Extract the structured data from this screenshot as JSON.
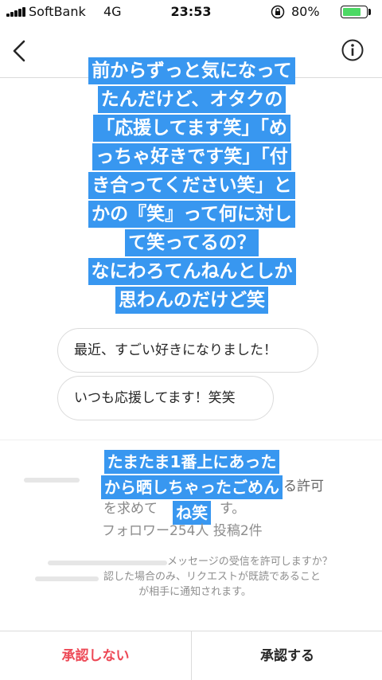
{
  "status_bar": {
    "carrier": "SoftBank",
    "network": "4G",
    "time": "23:53",
    "battery": "80%",
    "battery_level": 0.8,
    "icons": [
      "signal-icon",
      "orientation-lock-icon",
      "battery-icon"
    ]
  },
  "header": {
    "icons": [
      "back-chevron-icon",
      "info-icon"
    ]
  },
  "overlay_caption": {
    "lines": [
      "前からずっと気になって",
      "たんだけど、オタクの",
      "「応援してます笑」「め",
      "っちゃ好きです笑」「付",
      "き合ってください笑」と",
      "かの『笑』って何に対し",
      "て笑ってるの？",
      "なにわろてんねんとしか",
      "思わんのだけど笑"
    ],
    "color": "#3897f0"
  },
  "messages": [
    {
      "text": "最近、すごい好きになりました！"
    },
    {
      "text": "いつも応援してます！笑笑"
    }
  ],
  "overlay_caption_2": {
    "lines": [
      "たまたま1番上にあった",
      "から晒しちゃったごめん",
      "ね笑"
    ]
  },
  "request": {
    "text_tail": "る許可",
    "text_line2": "を求めて",
    "text_line2_tail": "す。",
    "stats": "フォロワー254人 投稿2件",
    "notice_line1": "メッセージの受信を許可しますか？",
    "notice_line2": "認した場合のみ、リクエストが既読であること",
    "notice_line3": "が相手に通知されます。"
  },
  "actions": {
    "decline": "承認しない",
    "accept": "承認する",
    "decline_color": "#ed4956"
  }
}
